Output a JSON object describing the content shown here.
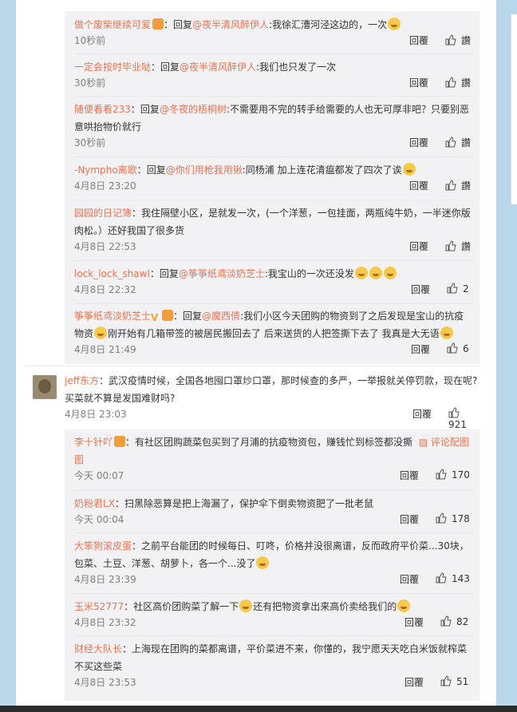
{
  "labels": {
    "reply": "回覆",
    "like_default": "讚",
    "reply_prefix": "回复",
    "map_link": "评论配图",
    "map_prefix": "图"
  },
  "nested_top": [
    {
      "user": "做个废柴继续可爱",
      "target": "@夜半清风醉伊人",
      "text": "我徐汇漕河泾这边的，一次",
      "time": "10秒前",
      "likes": "讚"
    },
    {
      "user": "一定会按时毕业哒",
      "target": "@夜半清风醉伊人",
      "text": "我们也只发了一次",
      "time": "30秒前",
      "likes": "讚"
    },
    {
      "user": "随便看看233",
      "target": "@冬夜的梧桐树",
      "text": "不需要用不完的转手给需要的人也无可厚非吧？只要别恶",
      "text2": "意哄抬物价就行",
      "time": "30秒前",
      "likes": "讚"
    },
    {
      "user": "-Nympho离歌",
      "target": "@你们用枪我用锹",
      "text": "同杨浦 加上连花清瘟都发了四次了诶",
      "time": "4月8日 23:20",
      "likes": "讚"
    },
    {
      "user": "园园的日记簿",
      "text": "我住隔壁小区，是就发一次，(一个洋葱，一包挂面，两瓶纯牛奶，一半迷你版",
      "text2": "肉松。）还好我国了很多货",
      "time": "4月8日 22:53",
      "likes": "讚"
    },
    {
      "user": "lock_lock_shawl",
      "target": "@筝筝纸鸢淡奶芝士",
      "text": "我宝山的一次还没发",
      "time": "4月8日 22:32",
      "likes": "2"
    },
    {
      "user": "筝筝纸鸢淡奶芝士",
      "target": "@魔西倩",
      "text": "我们小区今天团购的物资到了之后发现是宝山的抗疫",
      "text2a": "物资",
      "text2b": "刚开始有几箱带签的被居民搬回去了 后来送货的人把签撕下去了 我真是大无语",
      "time": "4月8日 21:49",
      "likes": "6"
    }
  ],
  "main_comment": {
    "user": "jeff东方",
    "text": "武汉疫情时候，全国各地囤口罩炒口罩，那时候查的多严，一举报就关停罚款，现在呢?",
    "text2": "买菜就不算是发国难财吗?",
    "time": "4月8日 23:03",
    "likes": "921"
  },
  "nested_bottom": [
    {
      "user": "李十针吖",
      "text": "有社区团购蔬菜包买到了月浦的抗疫物资包，赚钱忙到标签都没撕",
      "time": "今天 00:07",
      "likes": "170"
    },
    {
      "user": "奶粉君LX",
      "text": "扫黑除恶算是把上海漏了，保护伞下倒卖物资肥了一批老鼠",
      "time": "今天 00:04",
      "likes": "178"
    },
    {
      "user": "大笨狗滚皮蛋",
      "text": "之前平台能团的时候每日、叮咚，价格并没很离谱，反而政府平价菜...30块，",
      "text2": "包菜、土豆、洋葱、胡萝卜，各一个...没了",
      "time": "4月8日 23:39",
      "likes": "143"
    },
    {
      "user": "玉米52777",
      "text": "社区高价团购菜了解一下",
      "text_b": "还有把物资拿出来高价卖给我们的",
      "time": "4月8日 23:32",
      "likes": "82"
    },
    {
      "user": "财经大队长",
      "text": "上海现在团购的菜都离谱，平价菜进不来，你懂的，我宁愿天天吃白米饭就榨菜",
      "text2": "不买这些菜",
      "time": "4月8日 23:53",
      "likes": "51"
    }
  ]
}
